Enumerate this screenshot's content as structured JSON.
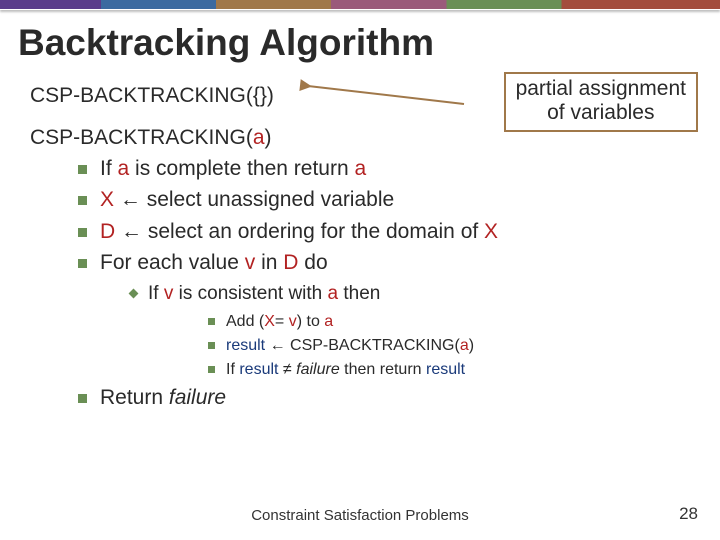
{
  "title": "Backtracking Algorithm",
  "callout": {
    "l1": "partial assignment",
    "l2": "of variables"
  },
  "call1": {
    "fn": "CSP-BACKTRACKING(",
    "arg": "{}",
    "close": ")"
  },
  "call2": {
    "fn": "CSP-BACKTRACKING(",
    "arg": "a",
    "close": ")"
  },
  "b1": {
    "t1": "If ",
    "a": "a",
    "t2": " is complete then return ",
    "a2": "a"
  },
  "b2": {
    "x": "X",
    "arrow": " ← ",
    "t": "select unassigned variable"
  },
  "b3": {
    "d": "D",
    "arrow": " ← ",
    "t1": "select an ordering for the domain of ",
    "x": "X"
  },
  "b4": {
    "t1": "For each value ",
    "v": "v",
    "t2": " in ",
    "d": "D",
    "t3": " do"
  },
  "s1": {
    "t1": "If ",
    "v": "v",
    "t2": " is consistent with ",
    "a": "a",
    "t3": " then"
  },
  "ss1": {
    "t1": "Add (",
    "x": "X",
    "eq": "= ",
    "v": "v",
    "t2": ") to ",
    "a": "a"
  },
  "ss2": {
    "r": "result",
    "arrow": " ← ",
    "fn": "CSP-BACKTRACKING(",
    "a": "a",
    "close": ")"
  },
  "ss3": {
    "t1": "If ",
    "r": "result",
    "neq": " ≠ ",
    "f": "failure",
    "t2": " then return ",
    "r2": "result"
  },
  "b5": {
    "t1": "Return ",
    "f": "failure"
  },
  "footer": "Constraint Satisfaction Problems",
  "page": "28"
}
